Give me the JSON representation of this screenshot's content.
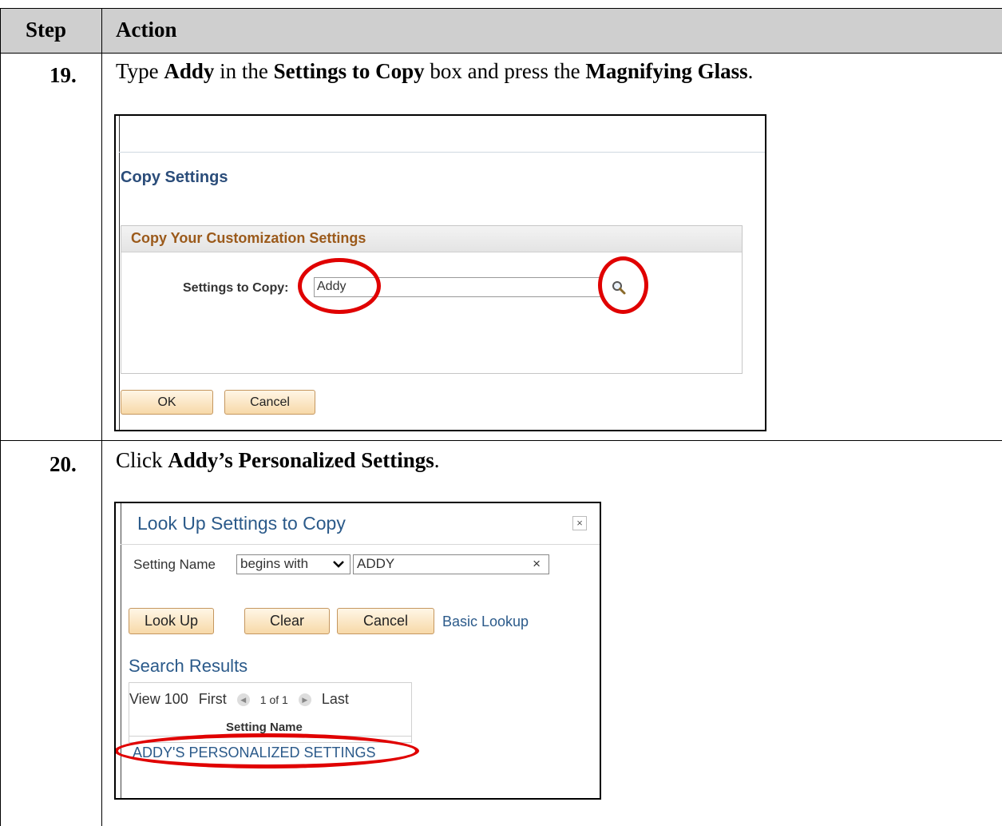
{
  "table": {
    "header": {
      "step": "Step",
      "action": "Action"
    }
  },
  "step19": {
    "number": "19.",
    "instruction": {
      "t1": "Type ",
      "b1": "Addy",
      "t2": " in the ",
      "b2": "Settings to Copy",
      "t3": " box and press the ",
      "b3": "Magnifying Glass",
      "t4": "."
    },
    "screenshot": {
      "page_title": "Copy Settings",
      "group_title": "Copy Your Customization Settings",
      "field_label": "Settings to Copy:",
      "field_value": "Addy",
      "ok_label": "OK",
      "cancel_label": "Cancel",
      "search_icon": "magnifier-icon"
    }
  },
  "step20": {
    "number": "20.",
    "instruction": {
      "t1": "Click ",
      "b1": "Addy’s Personalized Settings",
      "t2": "."
    },
    "screenshot": {
      "title": "Look Up Settings to Copy",
      "close": "×",
      "setting_name_label": "Setting Name",
      "operator": "begins with",
      "value": "ADDY",
      "clear_x": "×",
      "lookup_label": "Look Up",
      "clear_label": "Clear",
      "cancel_label": "Cancel",
      "basic_lookup": "Basic Lookup",
      "search_results": "Search Results",
      "nav": {
        "view": "View 100",
        "first": "First",
        "count": "1 of 1",
        "last": "Last"
      },
      "column_header": "Setting Name",
      "result": "ADDY'S PERSONALIZED SETTINGS"
    }
  },
  "colors": {
    "header_bg": "#cfcfcf",
    "highlight": "#e00000",
    "link": "#2b5a8a"
  }
}
